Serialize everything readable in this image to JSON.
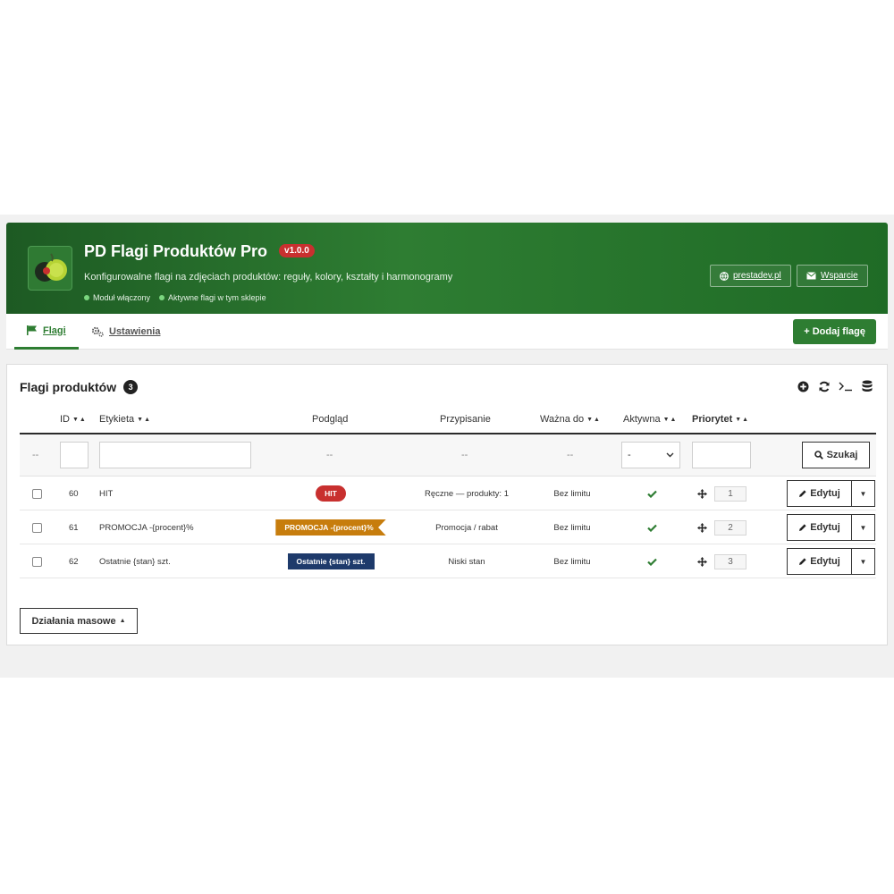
{
  "header": {
    "title": "PD Flagi Produktów Pro",
    "version": "v1.0.0",
    "subtitle": "Konfigurowalne flagi na zdjęciach produktów: reguły, kolory, kształty i harmonogramy",
    "status": [
      "Moduł włączony",
      "Aktywne flagi w tym sklepie"
    ],
    "links": [
      {
        "label": "prestadev.pl",
        "icon": "globe-icon"
      },
      {
        "label": "Wsparcie",
        "icon": "envelope-icon"
      }
    ]
  },
  "tabs": [
    {
      "label": "Flagi",
      "icon": "flag-icon",
      "active": true
    },
    {
      "label": "Ustawienia",
      "icon": "cogs-icon",
      "active": false
    }
  ],
  "add_button": "+ Dodaj flagę",
  "panel": {
    "title": "Flagi produktów",
    "count": "3",
    "tools": [
      "plus-circle-icon",
      "refresh-icon",
      "terminal-icon",
      "database-icon"
    ]
  },
  "columns": {
    "id": "ID",
    "label": "Etykieta",
    "preview": "Podgląd",
    "assignment": "Przypisanie",
    "valid_until": "Ważna do",
    "active": "Aktywna",
    "priority": "Priorytet"
  },
  "filters": {
    "placeholder_dash": "--",
    "preview": "--",
    "assignment": "--",
    "valid_until": "--",
    "active_select": "-",
    "search": "Szukaj"
  },
  "rows": [
    {
      "id": "60",
      "label": "HIT",
      "badge": "HIT",
      "badge_color": "#c8302f",
      "assignment": "Ręczne — produkty: 1",
      "valid_until": "Bez limitu",
      "priority": "1",
      "edit": "Edytuj"
    },
    {
      "id": "61",
      "label": "PROMOCJA -{procent}%",
      "badge": "PROMOCJA -{procent}%",
      "badge_color": "#c77d0d",
      "assignment": "Promocja / rabat",
      "valid_until": "Bez limitu",
      "priority": "2",
      "edit": "Edytuj"
    },
    {
      "id": "62",
      "label": "Ostatnie {stan} szt.",
      "badge": "Ostatnie {stan} szt.",
      "badge_color": "#1e3a6b",
      "assignment": "Niski stan",
      "valid_until": "Bez limitu",
      "priority": "3",
      "edit": "Edytuj"
    }
  ],
  "bulk_actions": "Działania masowe"
}
